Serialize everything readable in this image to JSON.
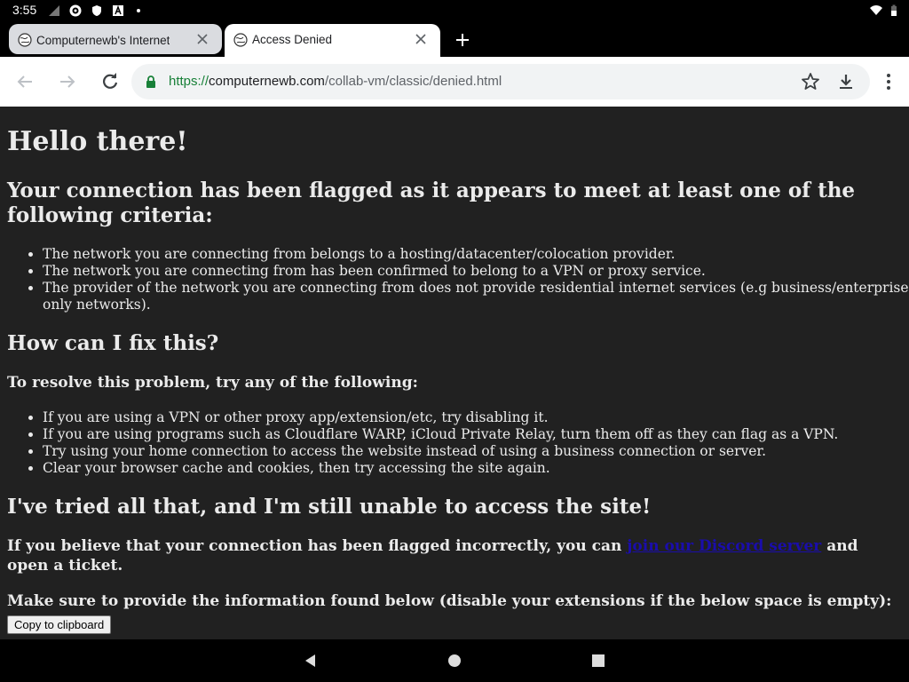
{
  "status_bar": {
    "time": "3:55",
    "icons": [
      "signal-off-icon",
      "gear-icon",
      "shield-icon",
      "text-a-icon",
      "dot-icon",
      "wifi-icon",
      "battery-icon"
    ]
  },
  "tabs": [
    {
      "title": "Computernewb's Internet Pub",
      "favicon": "globe-icon",
      "active": false
    },
    {
      "title": "Access Denied",
      "favicon": "globe-icon",
      "active": true
    }
  ],
  "toolbar": {
    "url_scheme": "https://",
    "url_host": "computernewb.com",
    "url_path": "/collab-vm/classic/denied.html"
  },
  "page": {
    "heading": "Hello there!",
    "flag_heading": "Your connection has been flagged as it appears to meet at least one of the following criteria:",
    "criteria": [
      "The network you are connecting from belongs to a hosting/datacenter/colocation provider.",
      "The network you are connecting from has been confirmed to belong to a VPN or proxy service.",
      "The provider of the network you are connecting from does not provide residential internet services (e.g business/enterprise-only networks)."
    ],
    "fix_heading": "How can I fix this?",
    "resolve_heading": "To resolve this problem, try any of the following:",
    "fixes": [
      "If you are using a VPN or other proxy app/extension/etc, try disabling it.",
      "If you are using programs such as Cloudflare WARP, iCloud Private Relay, turn them off as they can flag as a VPN.",
      "Try using your home connection to access the website instead of using a business connection or server.",
      "Clear your browser cache and cookies, then try accessing the site again."
    ],
    "tried_heading": "I've tried all that, and I'm still unable to access the site!",
    "incorrect_pre": "If you believe that your connection has been flagged incorrectly, you can ",
    "discord_link": "join our Discord server",
    "incorrect_post": " and open a ticket.",
    "info_heading": "Make sure to provide the information found below (disable your extensions if the below space is empty):",
    "copy_button": "Copy to clipboard"
  },
  "nav_bar": {
    "buttons": [
      "back-triangle-icon",
      "home-circle-icon",
      "recents-square-icon"
    ]
  }
}
